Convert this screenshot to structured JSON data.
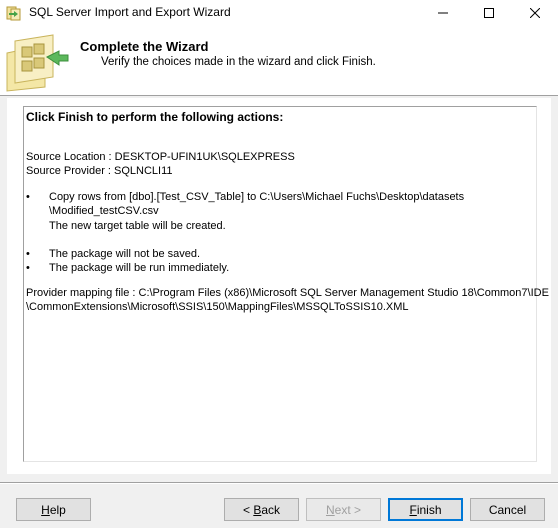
{
  "window": {
    "title": "SQL Server Import and Export Wizard"
  },
  "header": {
    "title": "Complete the Wizard",
    "subtitle": "Verify the choices made in the wizard and click Finish.",
    "art_icon": "wizard-folder-arrow-icon"
  },
  "summary": {
    "heading": "Click Finish to perform the following actions:",
    "source_location": "Source Location : DESKTOP-UFIN1UK\\SQLEXPRESS",
    "source_provider": "Source Provider : SQLNCLI11",
    "bullets": [
      {
        "lines": [
          "Copy rows from [dbo].[Test_CSV_Table] to C:\\Users\\Michael Fuchs\\Desktop\\datasets",
          "\\Modified_testCSV.csv"
        ]
      },
      {
        "lines": [
          "The new target table will be created."
        ]
      },
      {
        "lines": [
          "The package will not be saved."
        ]
      },
      {
        "lines": [
          "The package will be run immediately."
        ]
      }
    ],
    "provider_mapping": [
      "Provider mapping file : C:\\Program Files (x86)\\Microsoft SQL Server Management Studio 18\\Common7\\IDE",
      "\\CommonExtensions\\Microsoft\\SSIS\\150\\MappingFiles\\MSSQLToSSIS10.XML"
    ]
  },
  "buttons": {
    "help": {
      "mnemonic": "H",
      "rest": "elp"
    },
    "back": {
      "prefix": "< ",
      "mnemonic": "B",
      "rest": "ack"
    },
    "next": {
      "mnemonic": "N",
      "rest": "ext >"
    },
    "finish": {
      "mnemonic": "F",
      "rest": "inish"
    },
    "cancel": {
      "label": "Cancel"
    }
  },
  "colors": {
    "accent": "#0078d7",
    "window_bg": "#f0f0f0",
    "disabled_text": "#a0a0a0"
  }
}
